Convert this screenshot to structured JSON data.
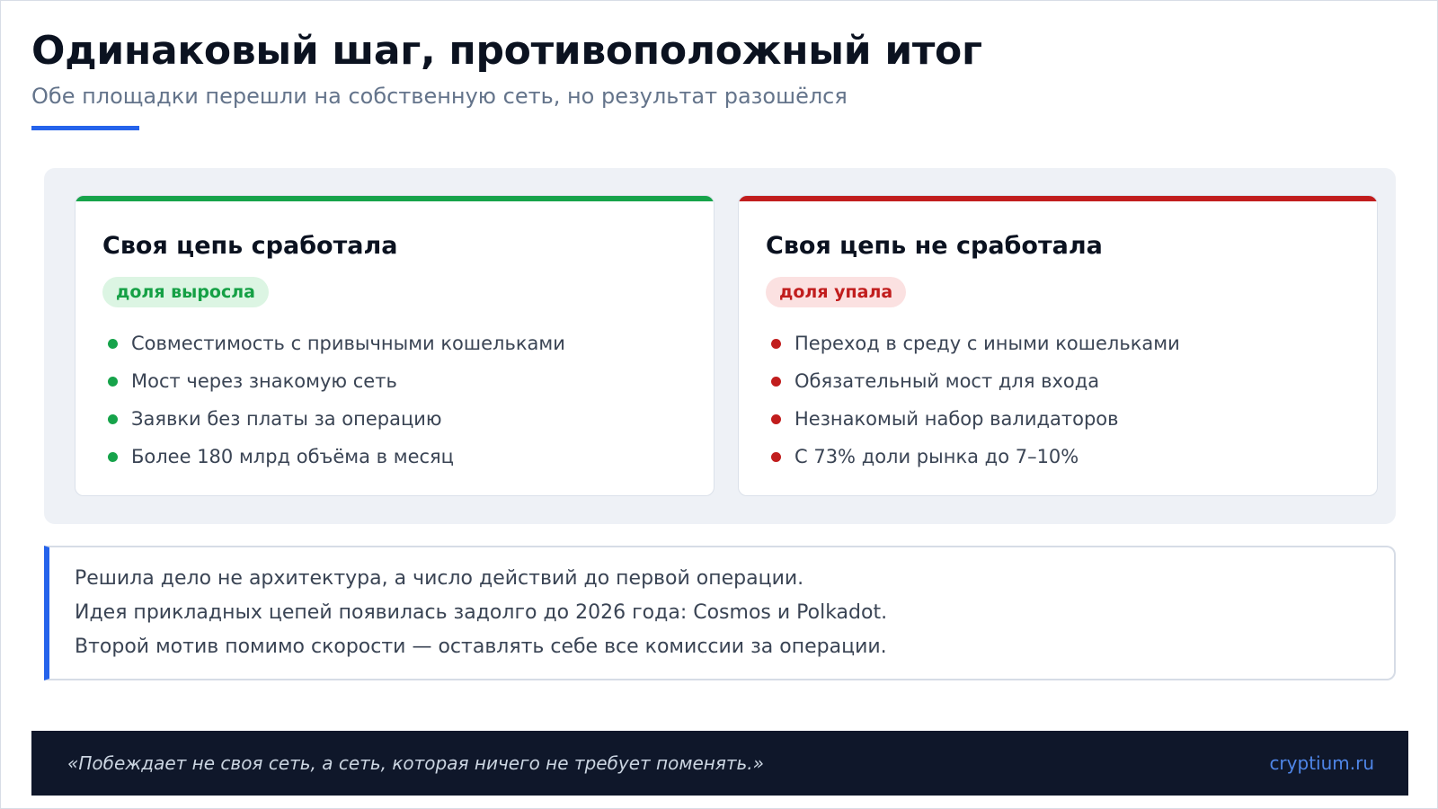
{
  "header": {
    "title": "Одинаковый шаг, противоположный итог",
    "subtitle": "Обе площадки перешли на собственную сеть, но результат разошёлся",
    "accent_color": "#2563eb"
  },
  "comparison": {
    "success": {
      "title": "Своя цепь сработала",
      "badge": "доля выросла",
      "color": "#16a34a",
      "items": [
        "Совместимость с привычными кошельками",
        "Мост через знакомую сеть",
        "Заявки без платы за операцию",
        "Более 180 млрд объёма в месяц"
      ]
    },
    "failure": {
      "title": "Своя цепь не сработала",
      "badge": "доля упала",
      "color": "#c11d1d",
      "items": [
        "Переход в среду с иными кошельками",
        "Обязательный мост для входа",
        "Незнакомый набор валидаторов",
        "С 73% доли рынка до 7–10%"
      ]
    }
  },
  "notes": [
    "Решила дело не архитектура, а число действий до первой операции.",
    "Идея прикладных цепей появилась задолго до 2026 года: Cosmos и Polkadot.",
    "Второй мотив помимо скорости — оставлять себе все комиссии за операции."
  ],
  "footer": {
    "quote": "«Побеждает не своя сеть, а сеть, которая ничего не требует поменять.»",
    "brand": "cryptium.ru",
    "background_color": "#0f172a",
    "brand_color": "#4f86e8"
  }
}
